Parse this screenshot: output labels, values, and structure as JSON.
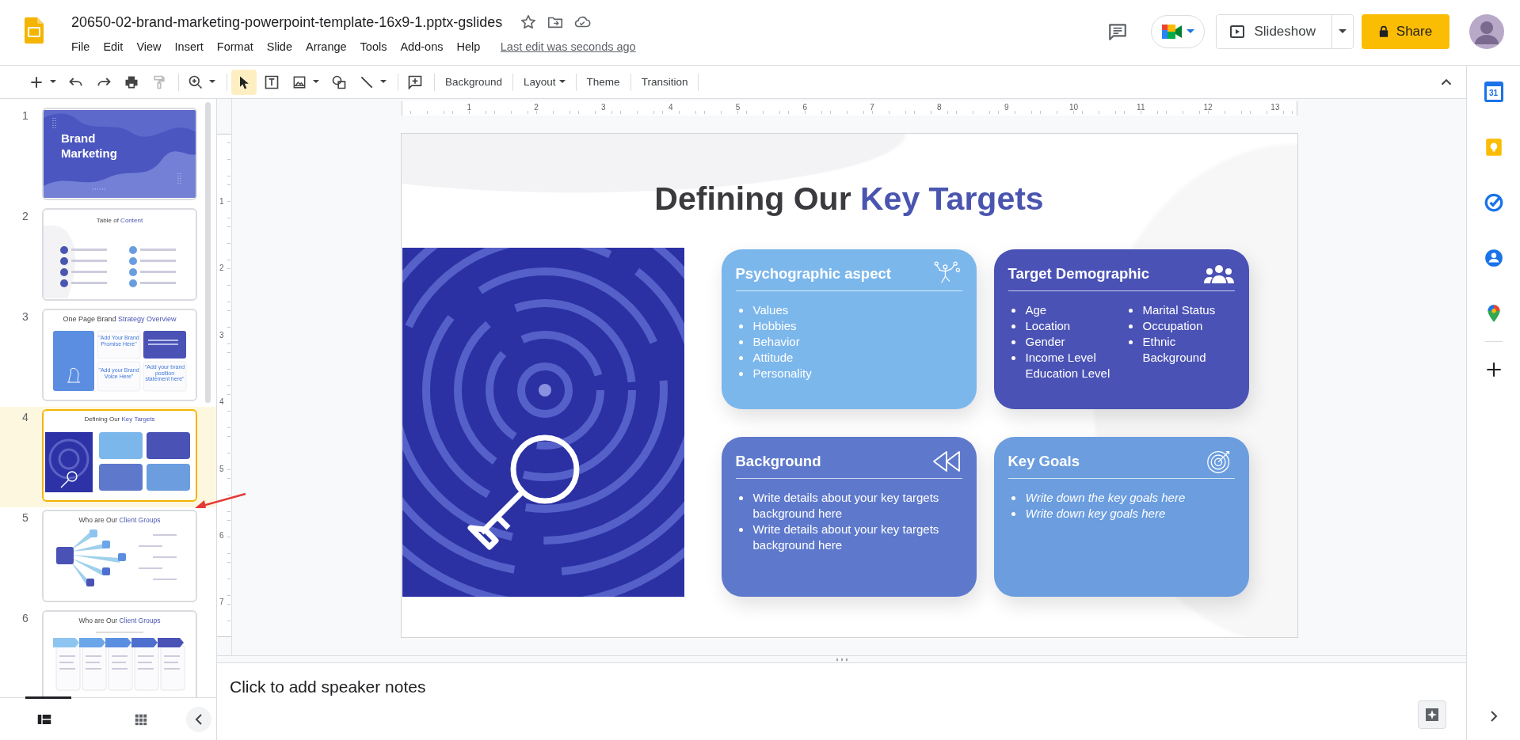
{
  "document": {
    "title": "20650-02-brand-marketing-powerpoint-template-16x9-1.pptx-gslides",
    "starred": false
  },
  "menu": [
    "File",
    "Edit",
    "View",
    "Insert",
    "Format",
    "Slide",
    "Arrange",
    "Tools",
    "Add-ons",
    "Help"
  ],
  "last_edit": "Last edit was seconds ago",
  "header": {
    "slideshow": "Slideshow",
    "share": "Share"
  },
  "toolbar": {
    "tools": [
      {
        "kind": "add",
        "dropdown": true,
        "selected": false
      },
      {
        "kind": "undo",
        "dropdown": false,
        "selected": false
      },
      {
        "kind": "redo",
        "dropdown": false,
        "selected": false
      },
      {
        "kind": "print",
        "dropdown": false,
        "selected": false
      },
      {
        "kind": "paint",
        "dropdown": false,
        "selected": false
      },
      {
        "kind": "zoom",
        "dropdown": true,
        "selected": false
      },
      {
        "kind": "select",
        "dropdown": false,
        "selected": true
      },
      {
        "kind": "textbox",
        "dropdown": false,
        "selected": false
      },
      {
        "kind": "image",
        "dropdown": true,
        "selected": false
      },
      {
        "kind": "shape",
        "dropdown": false,
        "selected": false
      },
      {
        "kind": "line",
        "dropdown": true,
        "selected": false
      },
      {
        "kind": "comment",
        "dropdown": false,
        "selected": false
      }
    ],
    "text_buttons": [
      {
        "label": "Background",
        "dropdown": false
      },
      {
        "label": "Layout",
        "dropdown": true
      },
      {
        "label": "Theme",
        "dropdown": false
      },
      {
        "label": "Transition",
        "dropdown": false
      }
    ]
  },
  "slides": [
    {
      "number": "1",
      "kind": "cover",
      "title": "Brand Marketing",
      "selected": false
    },
    {
      "number": "2",
      "kind": "toc",
      "title": "Table of",
      "title_accent": "Content",
      "selected": false
    },
    {
      "number": "3",
      "kind": "overview",
      "title": "One Page Brand",
      "title_accent": "Strategy Overview",
      "selected": false,
      "quotes": [
        "\"Add Your Brand Promise Here\"",
        "\"Add your Brand Voice Here\"",
        "\"Add your brand position statement here\""
      ]
    },
    {
      "number": "4",
      "kind": "targets",
      "title": "Defining Our",
      "title_accent": "Key Targets",
      "selected": true
    },
    {
      "number": "5",
      "kind": "hub",
      "title": "Who are Our",
      "title_accent": "Client Groups",
      "selected": false
    },
    {
      "number": "6",
      "kind": "steps",
      "title": "Who are Our",
      "title_accent": "Client Groups",
      "selected": false
    }
  ],
  "rulers": {
    "horizontal": [
      "1",
      "2",
      "3",
      "4",
      "5",
      "6",
      "7",
      "8",
      "9",
      "10",
      "11",
      "12",
      "13"
    ],
    "vertical": [
      "1",
      "2",
      "3",
      "4",
      "5",
      "6",
      "7"
    ]
  },
  "slide": {
    "title": "Defining Our",
    "title_accent": "Key Targets",
    "cards": [
      {
        "title": "Psychographic aspect",
        "color": "#7cb7ec",
        "kind": "list",
        "italic": false,
        "items": [
          {
            "text": "Values",
            "bullet": true
          },
          {
            "text": "Hobbies",
            "bullet": true
          },
          {
            "text": "Behavior",
            "bullet": true
          },
          {
            "text": "Attitude",
            "bullet": true
          },
          {
            "text": "Personality",
            "bullet": true
          }
        ]
      },
      {
        "title": "Target Demographic",
        "color": "#4a52b5",
        "kind": "columns",
        "italic": false,
        "columns": [
          [
            {
              "text": "Age",
              "bullet": true
            },
            {
              "text": "Location",
              "bullet": true
            },
            {
              "text": "Gender",
              "bullet": true
            },
            {
              "text": "Income Level",
              "bullet": true
            },
            {
              "text": "Education Level",
              "bullet": false
            }
          ],
          [
            {
              "text": "Marital Status",
              "bullet": true
            },
            {
              "text": "Occupation",
              "bullet": true
            },
            {
              "text": "Ethnic Background",
              "bullet": true
            }
          ]
        ]
      },
      {
        "title": "Background",
        "color": "#5e79cc",
        "kind": "list",
        "italic": false,
        "items": [
          {
            "text": "Write details about your key targets background here",
            "bullet": true
          },
          {
            "text": "Write details about your key targets background here",
            "bullet": true
          }
        ]
      },
      {
        "title": "Key Goals",
        "color": "#6b9ddf",
        "kind": "list",
        "italic": true,
        "items": [
          {
            "text": "Write down the key goals here",
            "bullet": true
          },
          {
            "text": "Write down key goals here",
            "bullet": true
          }
        ]
      }
    ]
  },
  "notes": {
    "placeholder": "Click to add speaker notes"
  },
  "side_panel": {
    "calendar_day": "31"
  }
}
